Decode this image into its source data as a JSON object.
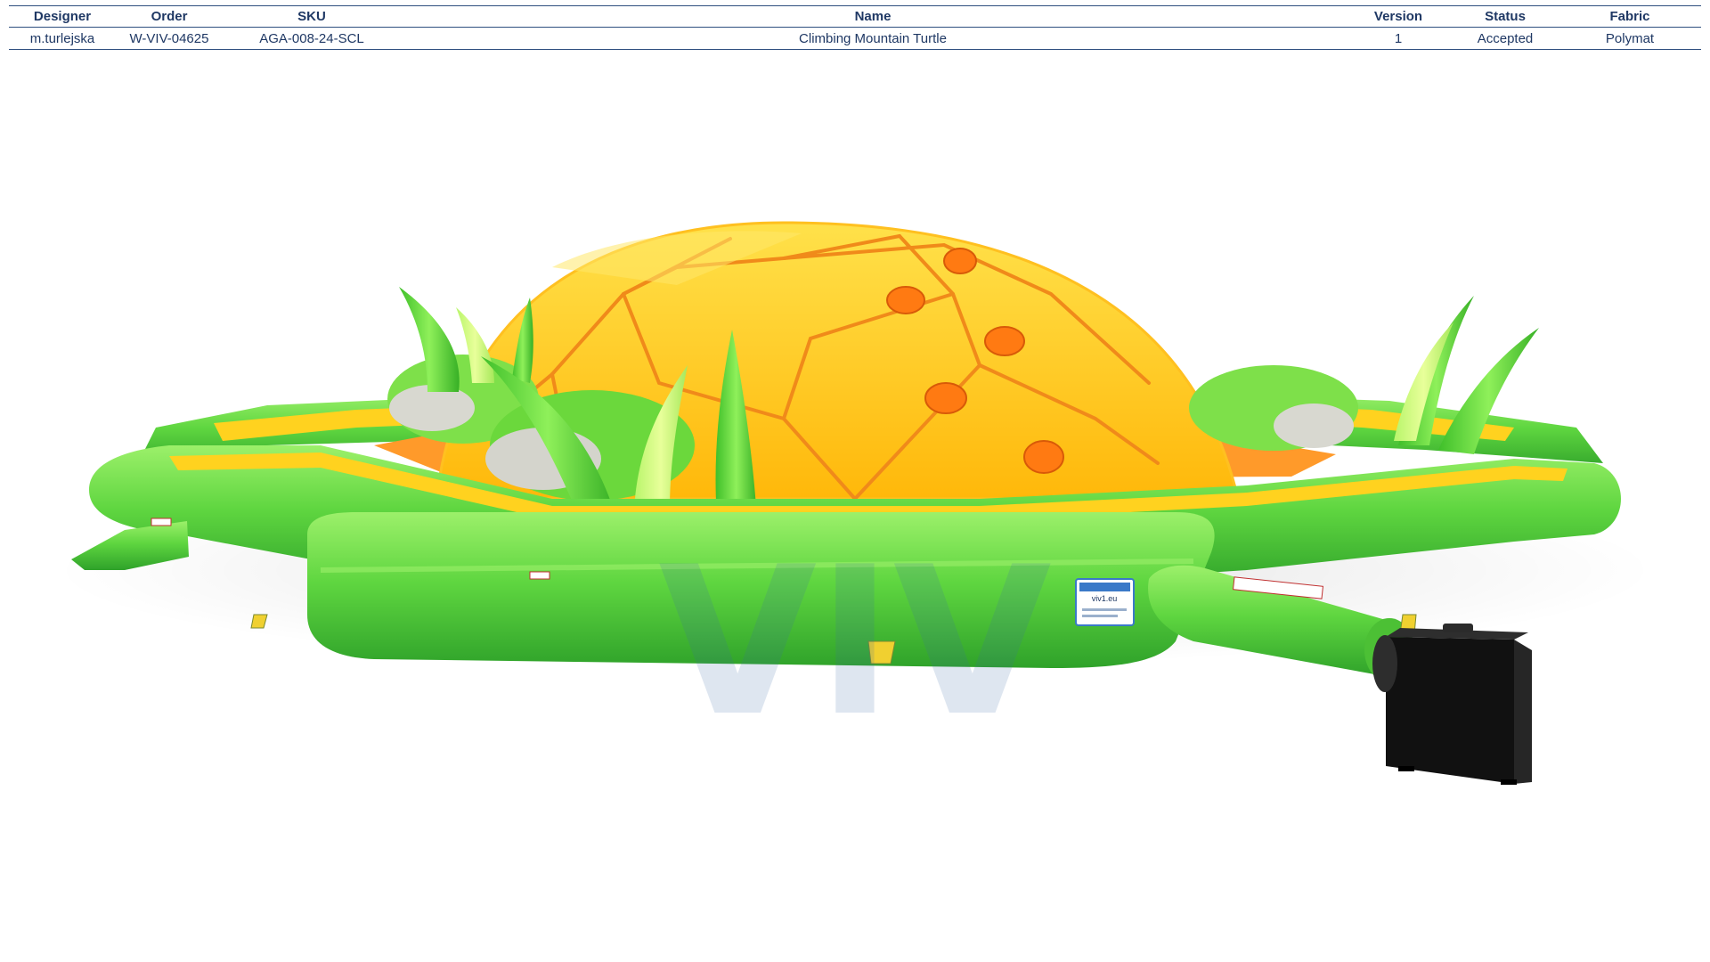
{
  "spec_sheet": {
    "columns": {
      "designer": "Designer",
      "order": "Order",
      "sku": "SKU",
      "name": "Name",
      "version": "Version",
      "status": "Status",
      "fabric": "Fabric"
    },
    "row": {
      "designer": "m.turlejska",
      "order": "W-VIV-04625",
      "sku": "AGA-008-24-SCL",
      "name": "Climbing Mountain Turtle",
      "version": "1",
      "status": "Accepted",
      "fabric": "Polymat"
    }
  },
  "render": {
    "watermark": "VIV",
    "label_brand": "viv1.eu",
    "colors": {
      "green": "#5fd640",
      "yellow": "#ffd21f",
      "orange": "#ff8a1a",
      "blower": "#1c1c1c"
    }
  }
}
